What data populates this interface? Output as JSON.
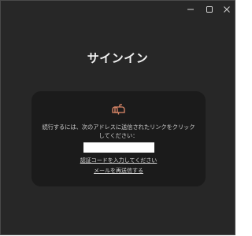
{
  "window": {
    "controls": {
      "minimize_icon": "minimize-icon",
      "maximize_icon": "maximize-icon",
      "close_icon": "close-icon"
    }
  },
  "page": {
    "title": "サインイン"
  },
  "card": {
    "icon": "mailbox-icon",
    "instruction": "続行するには、次のアドレスに送信されたリンクをクリックしてください：",
    "address_value": "",
    "links": {
      "enter_code": "認証コードを入力してください",
      "resend_email": "メールを再送信する"
    }
  },
  "colors": {
    "window_bg": "#272727",
    "card_bg": "#1b1b1b",
    "icon_accent": "#e08a6a",
    "text": "#f2f2f2"
  }
}
